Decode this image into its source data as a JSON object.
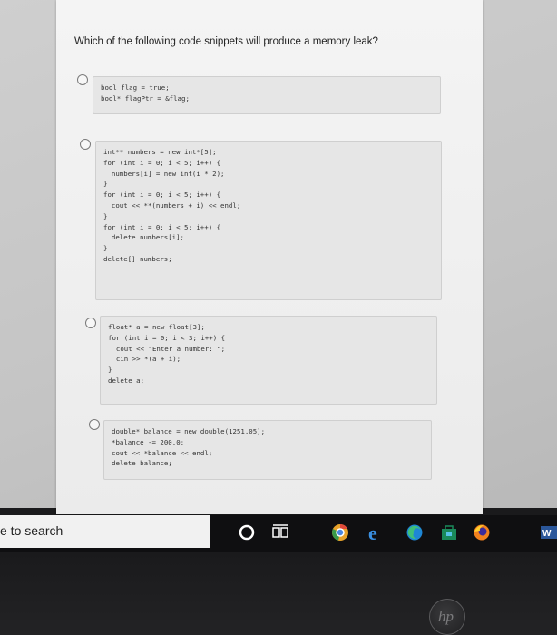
{
  "question": "Which of the following code snippets will produce a memory leak?",
  "options": [
    {
      "code": "bool flag = true;\nbool* flagPtr = &flag;"
    },
    {
      "code": "int** numbers = new int*[5];\nfor (int i = 0; i < 5; i++) {\n  numbers[i] = new int(i * 2);\n}\nfor (int i = 0; i < 5; i++) {\n  cout << **(numbers + i) << endl;\n}\nfor (int i = 0; i < 5; i++) {\n  delete numbers[i];\n}\ndelete[] numbers;"
    },
    {
      "code": "float* a = new float[3];\nfor (int i = 0; i < 3; i++) {\n  cout << \"Enter a number: \";\n  cin >> *(a + i);\n}\ndelete a;"
    },
    {
      "code": "double* balance = new double(1251.05);\n*balance -= 200.0;\ncout << *balance << endl;\ndelete balance;"
    }
  ],
  "taskbar": {
    "search_text": "e to search"
  },
  "device": {
    "logo_text": "hp"
  },
  "colors": {
    "taskbar": "#0f0f11",
    "page": "#f0f0f0"
  }
}
